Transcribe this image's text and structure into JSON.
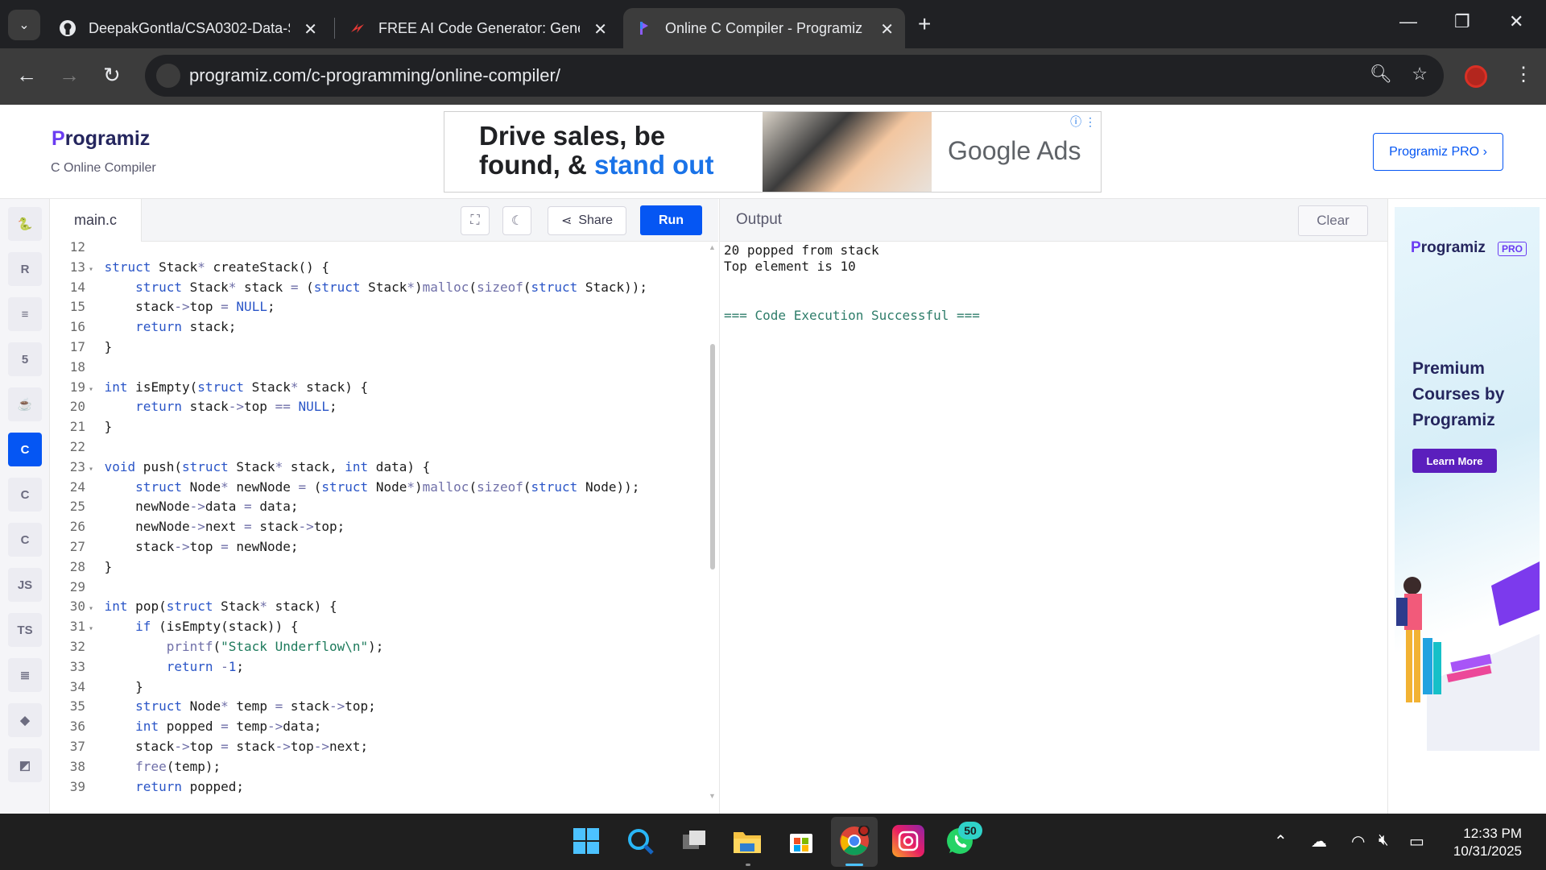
{
  "browser": {
    "tabs": [
      {
        "title": "DeepakGontla/CSA0302-Data-S",
        "icon": "github-icon"
      },
      {
        "title": "FREE AI Code Generator: Gener",
        "icon": "ai-generator-icon"
      },
      {
        "title": "Online C Compiler - Programiz",
        "icon": "programiz-icon",
        "active": true
      }
    ],
    "url": "programiz.com/c-programming/online-compiler/"
  },
  "header": {
    "logo": "rogramiz",
    "logo_initial": "P",
    "subtitle": "C Online Compiler",
    "pro_button": "Programiz PRO ›"
  },
  "ad_top": {
    "line1": "Drive sales, be",
    "line2_a": "found, & ",
    "line2_b": "stand out",
    "brand": "Google Ads"
  },
  "languages": [
    {
      "name": "python-icon",
      "glyph": "🐍"
    },
    {
      "name": "r-icon",
      "glyph": "R"
    },
    {
      "name": "sql-icon",
      "glyph": "≡"
    },
    {
      "name": "html-icon",
      "glyph": "5"
    },
    {
      "name": "java-icon",
      "glyph": "☕"
    },
    {
      "name": "c-icon",
      "glyph": "C",
      "active": true
    },
    {
      "name": "cpp-icon",
      "glyph": "C"
    },
    {
      "name": "csharp-icon",
      "glyph": "C"
    },
    {
      "name": "js-icon",
      "glyph": "JS"
    },
    {
      "name": "ts-icon",
      "glyph": "TS"
    },
    {
      "name": "go-icon",
      "glyph": "≣"
    },
    {
      "name": "swift-icon",
      "glyph": "◆"
    },
    {
      "name": "kotlin-icon",
      "glyph": "◩"
    }
  ],
  "editor": {
    "file_tab": "main.c",
    "share_label": "Share",
    "run_label": "Run",
    "lines": [
      {
        "n": "12",
        "fold": false,
        "tokens": []
      },
      {
        "n": "13",
        "fold": true,
        "tokens": [
          [
            "kw",
            "struct"
          ],
          [
            "src",
            " Stack"
          ],
          [
            "op",
            "*"
          ],
          [
            "src",
            " createStack() {"
          ]
        ]
      },
      {
        "n": "14",
        "fold": false,
        "tokens": [
          [
            "src",
            "    "
          ],
          [
            "kw",
            "struct"
          ],
          [
            "src",
            " Stack"
          ],
          [
            "op",
            "*"
          ],
          [
            "src",
            " stack "
          ],
          [
            "op",
            "="
          ],
          [
            "src",
            " ("
          ],
          [
            "kw",
            "struct"
          ],
          [
            "src",
            " Stack"
          ],
          [
            "op",
            "*"
          ],
          [
            "src",
            ")"
          ],
          [
            "fn",
            "malloc"
          ],
          [
            "src",
            "("
          ],
          [
            "fn",
            "sizeof"
          ],
          [
            "src",
            "("
          ],
          [
            "kw",
            "struct"
          ],
          [
            "src",
            " Stack));"
          ]
        ]
      },
      {
        "n": "15",
        "fold": false,
        "tokens": [
          [
            "src",
            "    stack"
          ],
          [
            "op",
            "->"
          ],
          [
            "src",
            "top "
          ],
          [
            "op",
            "="
          ],
          [
            "src",
            " "
          ],
          [
            "num",
            "NULL"
          ],
          [
            "src",
            ";"
          ]
        ]
      },
      {
        "n": "16",
        "fold": false,
        "tokens": [
          [
            "src",
            "    "
          ],
          [
            "kw",
            "return"
          ],
          [
            "src",
            " stack;"
          ]
        ]
      },
      {
        "n": "17",
        "fold": false,
        "tokens": [
          [
            "src",
            "}"
          ]
        ]
      },
      {
        "n": "18",
        "fold": false,
        "tokens": []
      },
      {
        "n": "19",
        "fold": true,
        "tokens": [
          [
            "kw",
            "int"
          ],
          [
            "src",
            " isEmpty("
          ],
          [
            "kw",
            "struct"
          ],
          [
            "src",
            " Stack"
          ],
          [
            "op",
            "*"
          ],
          [
            "src",
            " stack) {"
          ]
        ]
      },
      {
        "n": "20",
        "fold": false,
        "tokens": [
          [
            "src",
            "    "
          ],
          [
            "kw",
            "return"
          ],
          [
            "src",
            " stack"
          ],
          [
            "op",
            "->"
          ],
          [
            "src",
            "top "
          ],
          [
            "op",
            "=="
          ],
          [
            "src",
            " "
          ],
          [
            "num",
            "NULL"
          ],
          [
            "src",
            ";"
          ]
        ]
      },
      {
        "n": "21",
        "fold": false,
        "tokens": [
          [
            "src",
            "}"
          ]
        ]
      },
      {
        "n": "22",
        "fold": false,
        "tokens": []
      },
      {
        "n": "23",
        "fold": true,
        "tokens": [
          [
            "kw",
            "void"
          ],
          [
            "src",
            " push("
          ],
          [
            "kw",
            "struct"
          ],
          [
            "src",
            " Stack"
          ],
          [
            "op",
            "*"
          ],
          [
            "src",
            " stack, "
          ],
          [
            "kw",
            "int"
          ],
          [
            "src",
            " data) {"
          ]
        ]
      },
      {
        "n": "24",
        "fold": false,
        "tokens": [
          [
            "src",
            "    "
          ],
          [
            "kw",
            "struct"
          ],
          [
            "src",
            " Node"
          ],
          [
            "op",
            "*"
          ],
          [
            "src",
            " newNode "
          ],
          [
            "op",
            "="
          ],
          [
            "src",
            " ("
          ],
          [
            "kw",
            "struct"
          ],
          [
            "src",
            " Node"
          ],
          [
            "op",
            "*"
          ],
          [
            "src",
            ")"
          ],
          [
            "fn",
            "malloc"
          ],
          [
            "src",
            "("
          ],
          [
            "fn",
            "sizeof"
          ],
          [
            "src",
            "("
          ],
          [
            "kw",
            "struct"
          ],
          [
            "src",
            " Node));"
          ]
        ]
      },
      {
        "n": "25",
        "fold": false,
        "tokens": [
          [
            "src",
            "    newNode"
          ],
          [
            "op",
            "->"
          ],
          [
            "src",
            "data "
          ],
          [
            "op",
            "="
          ],
          [
            "src",
            " data;"
          ]
        ]
      },
      {
        "n": "26",
        "fold": false,
        "tokens": [
          [
            "src",
            "    newNode"
          ],
          [
            "op",
            "->"
          ],
          [
            "src",
            "next "
          ],
          [
            "op",
            "="
          ],
          [
            "src",
            " stack"
          ],
          [
            "op",
            "->"
          ],
          [
            "src",
            "top;"
          ]
        ]
      },
      {
        "n": "27",
        "fold": false,
        "tokens": [
          [
            "src",
            "    stack"
          ],
          [
            "op",
            "->"
          ],
          [
            "src",
            "top "
          ],
          [
            "op",
            "="
          ],
          [
            "src",
            " newNode;"
          ]
        ]
      },
      {
        "n": "28",
        "fold": false,
        "tokens": [
          [
            "src",
            "}"
          ]
        ]
      },
      {
        "n": "29",
        "fold": false,
        "tokens": []
      },
      {
        "n": "30",
        "fold": true,
        "tokens": [
          [
            "kw",
            "int"
          ],
          [
            "src",
            " pop("
          ],
          [
            "kw",
            "struct"
          ],
          [
            "src",
            " Stack"
          ],
          [
            "op",
            "*"
          ],
          [
            "src",
            " stack) {"
          ]
        ]
      },
      {
        "n": "31",
        "fold": true,
        "tokens": [
          [
            "src",
            "    "
          ],
          [
            "kw",
            "if"
          ],
          [
            "src",
            " (isEmpty(stack)) {"
          ]
        ]
      },
      {
        "n": "32",
        "fold": false,
        "tokens": [
          [
            "src",
            "        "
          ],
          [
            "fn",
            "printf"
          ],
          [
            "src",
            "("
          ],
          [
            "str",
            "\"Stack Underflow\\n\""
          ],
          [
            "src",
            ");"
          ]
        ]
      },
      {
        "n": "33",
        "fold": false,
        "tokens": [
          [
            "src",
            "        "
          ],
          [
            "kw",
            "return"
          ],
          [
            "src",
            " "
          ],
          [
            "op",
            "-"
          ],
          [
            "num",
            "1"
          ],
          [
            "src",
            ";"
          ]
        ]
      },
      {
        "n": "34",
        "fold": false,
        "tokens": [
          [
            "src",
            "    }"
          ]
        ]
      },
      {
        "n": "35",
        "fold": false,
        "tokens": [
          [
            "src",
            "    "
          ],
          [
            "kw",
            "struct"
          ],
          [
            "src",
            " Node"
          ],
          [
            "op",
            "*"
          ],
          [
            "src",
            " temp "
          ],
          [
            "op",
            "="
          ],
          [
            "src",
            " stack"
          ],
          [
            "op",
            "->"
          ],
          [
            "src",
            "top;"
          ]
        ]
      },
      {
        "n": "36",
        "fold": false,
        "tokens": [
          [
            "src",
            "    "
          ],
          [
            "kw",
            "int"
          ],
          [
            "src",
            " popped "
          ],
          [
            "op",
            "="
          ],
          [
            "src",
            " temp"
          ],
          [
            "op",
            "->"
          ],
          [
            "src",
            "data;"
          ]
        ]
      },
      {
        "n": "37",
        "fold": false,
        "tokens": [
          [
            "src",
            "    stack"
          ],
          [
            "op",
            "->"
          ],
          [
            "src",
            "top "
          ],
          [
            "op",
            "="
          ],
          [
            "src",
            " stack"
          ],
          [
            "op",
            "->"
          ],
          [
            "src",
            "top"
          ],
          [
            "op",
            "->"
          ],
          [
            "src",
            "next;"
          ]
        ]
      },
      {
        "n": "38",
        "fold": false,
        "tokens": [
          [
            "src",
            "    "
          ],
          [
            "fn",
            "free"
          ],
          [
            "src",
            "(temp);"
          ]
        ]
      },
      {
        "n": "39",
        "fold": false,
        "tokens": [
          [
            "src",
            "    "
          ],
          [
            "kw",
            "return"
          ],
          [
            "src",
            " popped;"
          ]
        ]
      }
    ]
  },
  "output": {
    "title": "Output",
    "clear_label": "Clear",
    "lines": [
      "20 popped from stack",
      "Top element is 10",
      "",
      "",
      "=== Code Execution Successful ==="
    ]
  },
  "side_ad": {
    "logo": "rogramiz",
    "logo_initial": "P",
    "pro": "PRO",
    "title": "Premium Courses by Programiz",
    "button": "Learn More"
  },
  "taskbar": {
    "whatsapp_badge": "50",
    "time": "12:33 PM",
    "date": "10/31/2025"
  },
  "colors": {
    "accent": "#0556f3",
    "brand_purple": "#6b3cf2",
    "keyword": "#2a55c7",
    "success": "#2e7d6a"
  }
}
